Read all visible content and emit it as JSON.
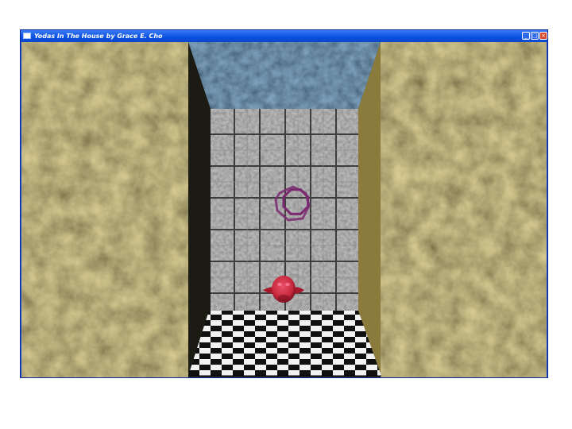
{
  "window": {
    "title": "Yodas In The House by Grace E. Cho",
    "controls": {
      "minimize_glyph": "_",
      "maximize_glyph": "□",
      "close_glyph": "×"
    },
    "icons": {
      "app": "window-app-icon",
      "minimize": "minimize-icon",
      "maximize": "maximize-icon",
      "close": "close-icon"
    }
  },
  "scene": {
    "colors": {
      "side_wall": "#6b5d2e",
      "side_wall_dark": "#4c4322",
      "ceiling": "#1f3447",
      "back_wall": "#5a5a58",
      "floor_light": "#f2f2f2",
      "floor_dark": "#101010",
      "ring": "#7a2a70",
      "creature": "#c8283c"
    },
    "objects": [
      "crosshair-ring",
      "red-creature",
      "checkered-floor"
    ]
  }
}
